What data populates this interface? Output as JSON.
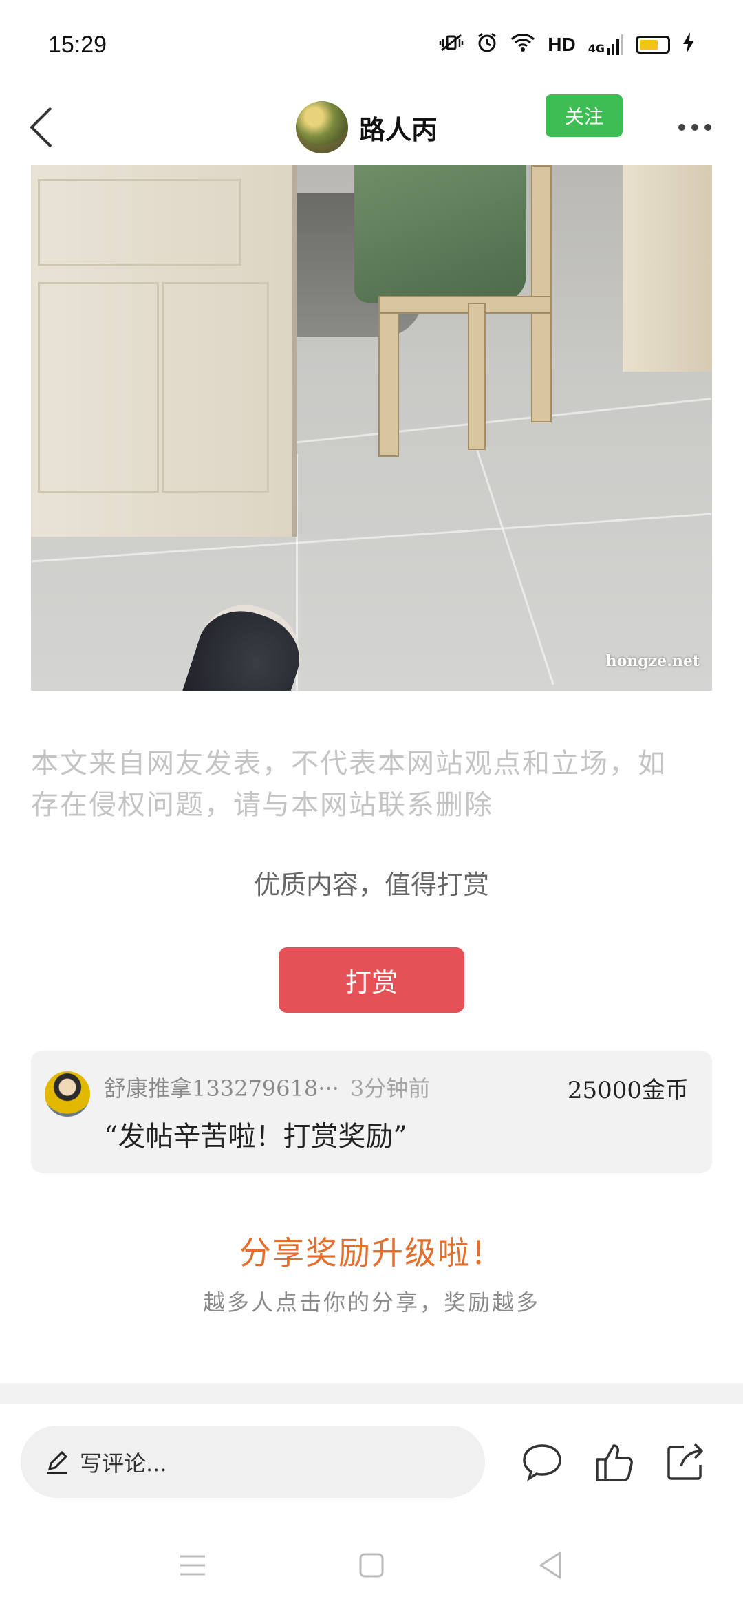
{
  "status_bar": {
    "time": "15:29",
    "network": "HD",
    "signal": "4G",
    "icons": [
      "vibrate-mute-icon",
      "alarm-icon",
      "wifi-icon",
      "signal-icon",
      "battery-icon",
      "charging-icon"
    ],
    "battery_color": "#f3c316"
  },
  "header": {
    "author_name": "路人丙",
    "follow_label": "关注",
    "follow_color": "#3fbd55",
    "icons": [
      "back-arrow-icon",
      "more-icon"
    ]
  },
  "post": {
    "image_watermark": "hongze.net",
    "disclaimer_line1": "本文来自网友发表，不代表本网站观点和立场，如",
    "disclaimer_line2": "存在侵权问题，请与本网站联系删除"
  },
  "reward": {
    "prompt": "优质内容，值得打赏",
    "button_label": "打赏",
    "button_color": "#e45257",
    "record": {
      "user": "舒康推拿133279618···",
      "time": "3分钟前",
      "amount": "25000金币",
      "message": "“发帖辛苦啦！打赏奖励”"
    }
  },
  "share": {
    "title": "分享奖励升级啦！",
    "subtitle": "越多人点击你的分享，奖励越多",
    "title_color": "#e36e2d"
  },
  "bottom_bar": {
    "comment_placeholder": "写评论...",
    "icons": [
      "pencil-icon",
      "comment-icon",
      "like-icon",
      "share-icon"
    ]
  },
  "nav": {
    "icons": [
      "menu-icon",
      "home-icon",
      "back-icon"
    ]
  }
}
